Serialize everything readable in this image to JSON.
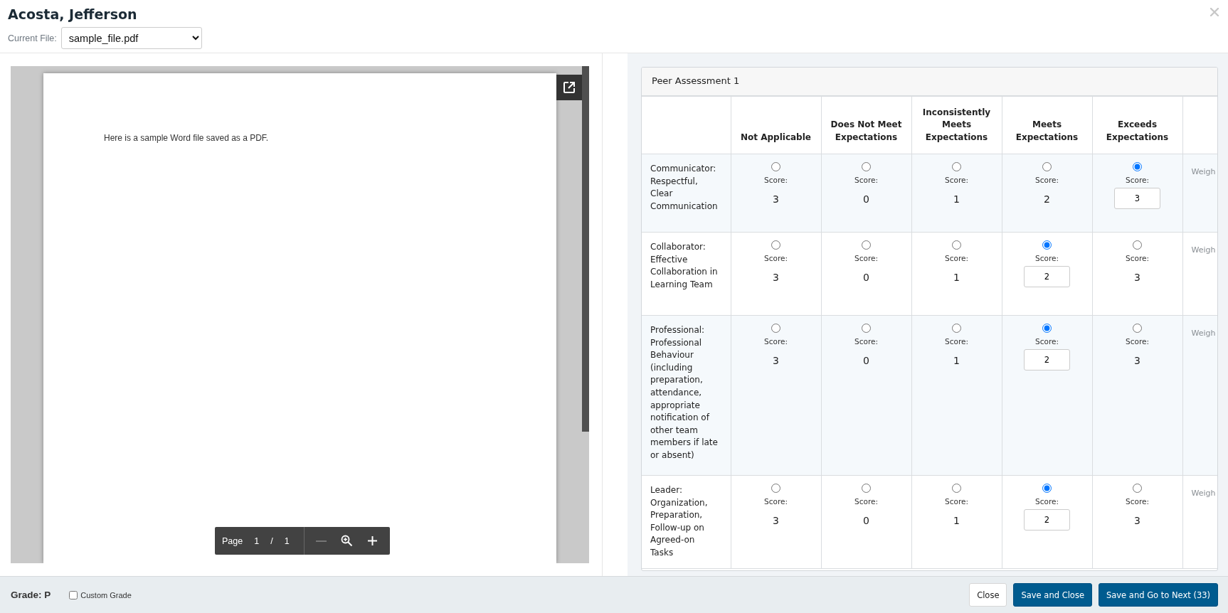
{
  "header": {
    "title": "Acosta, Jefferson",
    "file_label": "Current File:",
    "file_value": "sample_file.pdf"
  },
  "document": {
    "text": "Here is a sample Word file saved as a PDF.",
    "toolbar": {
      "page_label": "Page",
      "page": "1",
      "separator": "/",
      "total": "1"
    }
  },
  "assessment": {
    "title": "Peer Assessment 1",
    "columns": [
      "Not Applicable",
      "Does Not Meet Expectations",
      "Inconsistently Meets Expectations",
      "Meets Expectations",
      "Exceeds Expectations"
    ],
    "criteria": [
      {
        "label": "Communicator: Respectful, Clear Communication",
        "column_7": "Weigh",
        "options": [
          {
            "score_label": "Score:",
            "score": "3",
            "selected": false
          },
          {
            "score_label": "Score:",
            "score": "0",
            "selected": false
          },
          {
            "score_label": "Score:",
            "score": "1",
            "selected": false
          },
          {
            "score_label": "Score:",
            "score": "2",
            "selected": false
          },
          {
            "score_label": "Score:",
            "score": "3",
            "selected": true
          }
        ]
      },
      {
        "label": "Collaborator: Effective Collaboration in Learning Team",
        "column_7": "Weigh",
        "options": [
          {
            "score_label": "Score:",
            "score": "3",
            "selected": false
          },
          {
            "score_label": "Score:",
            "score": "0",
            "selected": false
          },
          {
            "score_label": "Score:",
            "score": "1",
            "selected": false
          },
          {
            "score_label": "Score:",
            "score": "2",
            "selected": true
          },
          {
            "score_label": "Score:",
            "score": "3",
            "selected": false
          }
        ]
      },
      {
        "label": "Professional: Professional Behaviour (including preparation, attendance, appropriate notification of other team members if late or absent)",
        "column_7": "Weigh",
        "options": [
          {
            "score_label": "Score:",
            "score": "3",
            "selected": false
          },
          {
            "score_label": "Score:",
            "score": "0",
            "selected": false
          },
          {
            "score_label": "Score:",
            "score": "1",
            "selected": false
          },
          {
            "score_label": "Score:",
            "score": "2",
            "selected": true
          },
          {
            "score_label": "Score:",
            "score": "3",
            "selected": false
          }
        ]
      },
      {
        "label": "Leader: Organization, Preparation, Follow-up on Agreed-on Tasks",
        "column_7": "Weigh",
        "options": [
          {
            "score_label": "Score:",
            "score": "3",
            "selected": false
          },
          {
            "score_label": "Score:",
            "score": "0",
            "selected": false
          },
          {
            "score_label": "Score:",
            "score": "1",
            "selected": false
          },
          {
            "score_label": "Score:",
            "score": "2",
            "selected": true
          },
          {
            "score_label": "Score:",
            "score": "3",
            "selected": false
          }
        ]
      }
    ]
  },
  "footer": {
    "grade": "Grade: P",
    "custom_grade": {
      "label": "Custom Grade",
      "checked": false
    },
    "buttons": [
      {
        "label": "Close",
        "kind": "secondary"
      },
      {
        "label": "Save and Close",
        "kind": "primary"
      },
      {
        "label": "Save and Go to Next (33)",
        "kind": "primary"
      }
    ]
  }
}
